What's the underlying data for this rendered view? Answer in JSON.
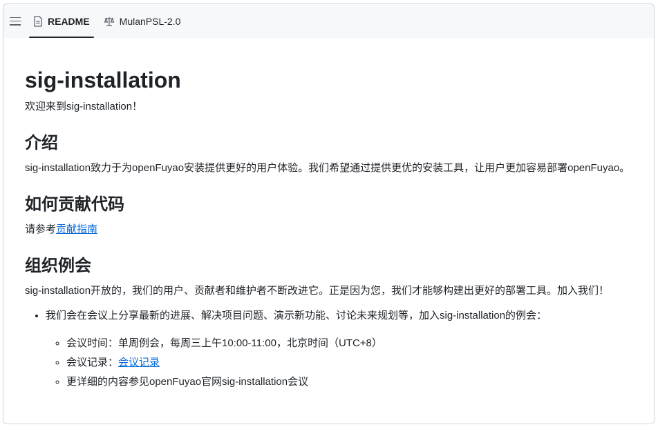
{
  "tabs": {
    "readme": "README",
    "license": "MulanPSL-2.0"
  },
  "title": "sig-installation",
  "welcome": "欢迎来到sig-installation！",
  "intro": {
    "heading": "介绍",
    "text": "sig-installation致力于为openFuyao安装提供更好的用户体验。我们希望通过提供更优的安装工具，让用户更加容易部署openFuyao。"
  },
  "contribute": {
    "heading": "如何贡献代码",
    "prefix": "请参考",
    "link": "贡献指南"
  },
  "meeting": {
    "heading": "组织例会",
    "text": "sig-installation开放的，我们的用户、贡献者和维护者不断改进它。正是因为您，我们才能够构建出更好的部署工具。加入我们！",
    "bullet": "我们会在会议上分享最新的进展、解决项目问题、演示新功能、讨论未来规划等，加入sig-installation的例会：",
    "time": "会议时间：单周例会，每周三上午10:00-11:00，北京时间（UTC+8）",
    "record_prefix": "会议记录：",
    "record_link": "会议记录",
    "more": "更详细的内容参见openFuyao官网sig-installation会议"
  }
}
